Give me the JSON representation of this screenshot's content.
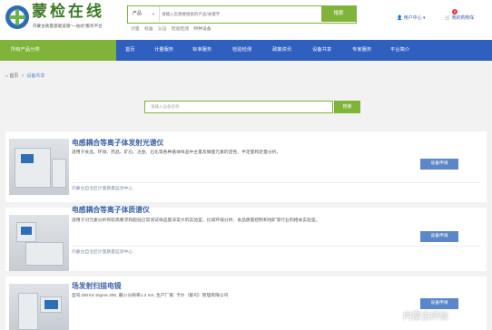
{
  "header": {
    "logo_title": "蒙检在线",
    "logo_subtitle": "内蒙古质量基础设施\"一站式\"服务平台",
    "search": {
      "category": "产品",
      "placeholder": "请输入您想要搜索的产品/关键字",
      "button": "搜索"
    },
    "hot_words": [
      "计量",
      "标准",
      "认证",
      "检验检测",
      "特种设备"
    ],
    "user_center": "用户中心",
    "cart": "我的购物车",
    "cart_count": "0"
  },
  "nav": {
    "all_label": "所有产品分类",
    "items": [
      "首页",
      "计量服务",
      "标准服务",
      "检验检测",
      "政策资讯",
      "设备共享",
      "专家服务",
      "平台简介"
    ]
  },
  "breadcrumb": {
    "home": "首页",
    "current": "设备共享"
  },
  "equipment_search": {
    "placeholder": "请输入设备名称",
    "button": "搜索"
  },
  "equipment": [
    {
      "title": "电感耦合等离子体发射光谱仪",
      "description": "适用于食品、环境、药品、矿石、冶金、石化等各种基体样品中主量及微量元素的定性、半定量和定量分析。",
      "organization": "内蒙古自治区计量质量监测中心",
      "apply": "设备申请"
    },
    {
      "title": "电感耦合等离子体质谱仪",
      "description": "适用于对元素分析有较高要求和超低已常测试样品量非常大的实验室，比如环境分析、食品质量控制和地矿等行业的相关实验室。",
      "organization": "内蒙古自治区计量质量监测中心",
      "apply": "设备申请"
    },
    {
      "title": "场发射扫描电镜",
      "description": "型号:ZEISS Sigma 300, 最小分辨率1.2 nm, 生产厂家: 卡尔（蔡司）管理有限公司",
      "organization": "",
      "apply": "设备申请"
    }
  ],
  "watermark": "内蒙古纤检",
  "colors": {
    "green": "#7fb33a",
    "nav_blue": "#2f5fbf",
    "title_blue": "#3b63a8",
    "button_blue": "#5b86c9"
  }
}
